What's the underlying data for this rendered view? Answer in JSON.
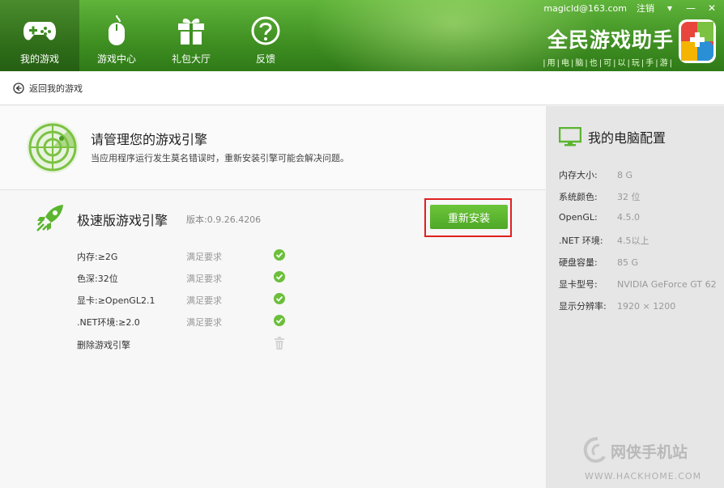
{
  "nav": [
    {
      "label": "我的游戏",
      "icon": "gamepad-icon",
      "active": true
    },
    {
      "label": "游戏中心",
      "icon": "mouse-icon",
      "active": false
    },
    {
      "label": "礼包大厅",
      "icon": "gift-icon",
      "active": false
    },
    {
      "label": "反馈",
      "icon": "question-icon",
      "active": false
    }
  ],
  "topbar": {
    "user": "magicld@163.com",
    "logout": "注销",
    "menu": "▾",
    "minimize": "—",
    "close": "✕"
  },
  "brand": {
    "title": "全民游戏助手",
    "slogan": "|用|电|脑|也|可|以|玩|手|游|"
  },
  "subbar": {
    "back_label": "返回我的游戏"
  },
  "intro": {
    "title": "请管理您的游戏引擎",
    "desc": "当应用程序运行发生莫名错误时，重新安装引擎可能会解决问题。"
  },
  "engine": {
    "name": "极速版游戏引擎",
    "version": "版本:0.9.26.4206",
    "reinstall_label": "重新安装"
  },
  "requirements": [
    {
      "name": "内存:≥2G",
      "status": "满足要求"
    },
    {
      "name": "色深:32位",
      "status": "满足要求"
    },
    {
      "name": "显卡:≥OpenGL2.1",
      "status": "满足要求"
    },
    {
      "name": ".NET环境:≥2.0",
      "status": "满足要求"
    }
  ],
  "delete_label": "删除游戏引擎",
  "side": {
    "title": "我的电脑配置",
    "specs": [
      {
        "k": "内存大小:",
        "v": "8 G"
      },
      {
        "k": "系统颜色:",
        "v": "32 位"
      },
      {
        "k": "OpenGL:",
        "v": "4.5.0"
      },
      {
        "k": ".NET 环境:",
        "v": "4.5以上"
      },
      {
        "k": "硬盘容量:",
        "v": "85 G"
      },
      {
        "k": "显卡型号:",
        "v": "NVIDIA GeForce GT 62"
      },
      {
        "k": "显示分辨率:",
        "v": "1920 × 1200"
      }
    ]
  },
  "watermark": {
    "text": "网侠手机站",
    "url": "WWW.HACKHOME.COM"
  },
  "colors": {
    "header_green": "#3f8f22",
    "button_green": "#5bb530",
    "check_green": "#6bbf3a",
    "highlight_red": "#e02020"
  }
}
